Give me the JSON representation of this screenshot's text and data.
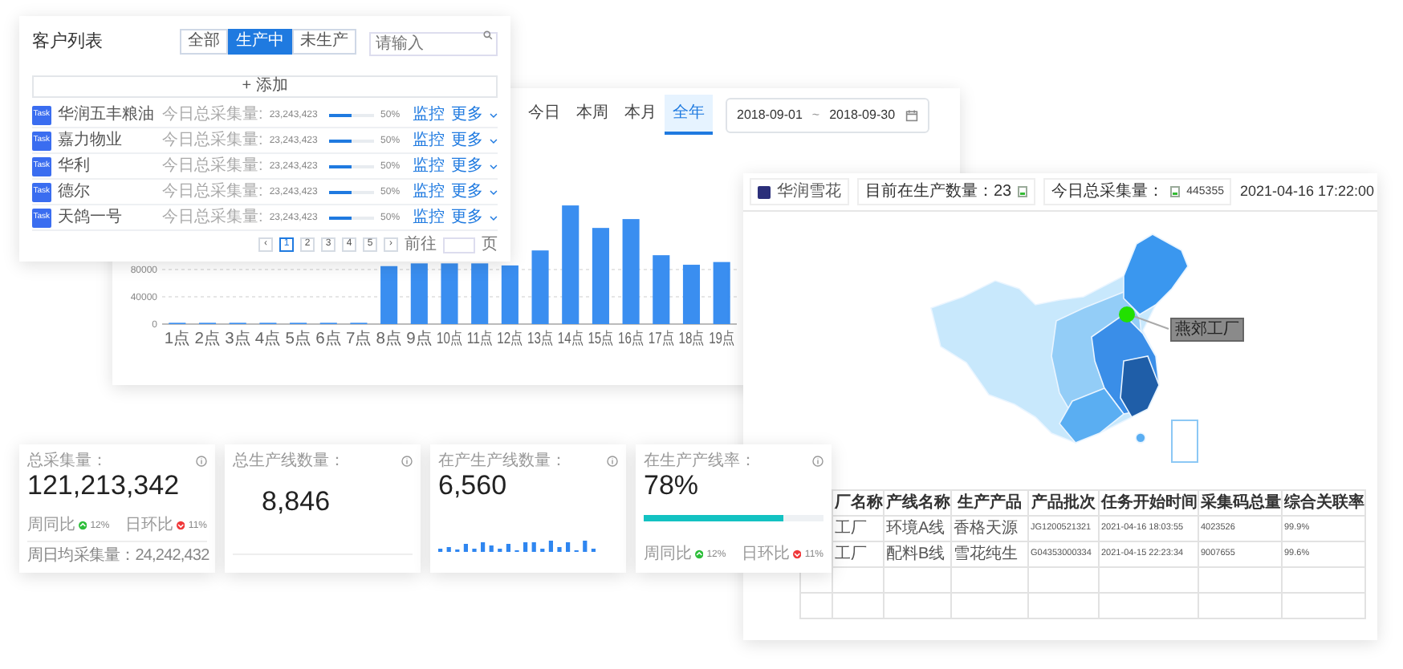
{
  "customer_list": {
    "title": "客户列表",
    "filters": [
      {
        "label": "全部",
        "selected": false
      },
      {
        "label": "生产中",
        "selected": true
      },
      {
        "label": "未生产",
        "selected": false
      }
    ],
    "search": {
      "placeholder": "请输入"
    },
    "add_button": "+ 添加",
    "rows": [
      {
        "badge": "Task",
        "name": "华润五丰粮油",
        "label": "今日总采集量:",
        "value": "23,243,423",
        "level": 0.5,
        "percent": "50%",
        "action": "监控",
        "more": "更多"
      },
      {
        "badge": "Task",
        "name": "嘉力物业",
        "label": "今日总采集量:",
        "value": "23,243,423",
        "level": 0.5,
        "percent": "50%",
        "action": "监控",
        "more": "更多"
      },
      {
        "badge": "Task",
        "name": "华利",
        "label": "今日总采集量:",
        "value": "23,243,423",
        "level": 0.5,
        "percent": "50%",
        "action": "监控",
        "more": "更多"
      },
      {
        "badge": "Task",
        "name": "德尔",
        "label": "今日总采集量:",
        "value": "23,243,423",
        "level": 0.5,
        "percent": "50%",
        "action": "监控",
        "more": "更多"
      },
      {
        "badge": "Task",
        "name": "天鸽一号",
        "label": "今日总采集量:",
        "value": "23,243,423",
        "level": 0.5,
        "percent": "50%",
        "action": "监控",
        "more": "更多"
      }
    ],
    "pagination": {
      "prev": "‹",
      "pages": [
        {
          "label": "1",
          "selected": true
        },
        {
          "label": "2",
          "selected": false
        },
        {
          "label": "3",
          "selected": false
        },
        {
          "label": "4",
          "selected": false
        },
        {
          "label": "5",
          "selected": false
        }
      ],
      "next": "›",
      "goto_label": "前往",
      "goto_suffix": "页"
    }
  },
  "trend_chart": {
    "tabs": [
      {
        "label": "今日",
        "selected": false
      },
      {
        "label": "本周",
        "selected": false
      },
      {
        "label": "本月",
        "selected": false
      },
      {
        "label": "全年",
        "selected": true
      }
    ],
    "date_start": "2018-09-01",
    "date_separator": "~",
    "date_end": "2018-09-30",
    "chart_data": {
      "type": "bar",
      "categories": [
        "1点",
        "2点",
        "3点",
        "4点",
        "5点",
        "6点",
        "7点",
        "8点",
        "9点",
        "10点",
        "11点",
        "12点",
        "13点",
        "14点",
        "15点",
        "16点",
        "17点",
        "18点",
        "19点"
      ],
      "series": [
        {
          "color": "#3a8ef0",
          "values": [
            0,
            0,
            0,
            0,
            0,
            0,
            0,
            85000,
            89000,
            89000,
            89000,
            86000,
            108000,
            174000,
            141000,
            154000,
            101000,
            87000,
            91000
          ]
        }
      ],
      "ylim": [
        0,
        180000
      ],
      "yticks": [
        0,
        40000,
        80000
      ]
    }
  },
  "stats": [
    {
      "kind": "footer",
      "label": "总采集量：",
      "value": "121,213,342",
      "trends": [
        {
          "label": "周同比",
          "up": true,
          "value": "12%"
        },
        {
          "label": "日环比",
          "up": false,
          "value": "11%"
        }
      ],
      "footer": "周日均采集量：24,242,432"
    },
    {
      "kind": "plain",
      "label": "总生产线数量：",
      "value": "8,846"
    },
    {
      "kind": "sparkline",
      "label": "在产生产线数量：",
      "value": "6,560"
    },
    {
      "kind": "progress",
      "label": "在生产产线率：",
      "value": "78%",
      "level": 0.78,
      "trends": [
        {
          "label": "周同比",
          "up": true,
          "value": "12%"
        },
        {
          "label": "日环比",
          "up": false,
          "value": "11%"
        }
      ]
    }
  ],
  "factory_map": {
    "brand": "华润雪花",
    "producing": "目前在生产数量：23",
    "total_label": "今日总采集量：",
    "total_value": "445355",
    "datetime": "2021-04-16 17:22:00",
    "marker_label": "燕郊工厂",
    "table": {
      "columns": [
        "厂名称",
        "产线名称",
        "生产产品",
        "产品批次",
        "任务开始时间",
        "采集码总量",
        "综合关联率"
      ],
      "rows": [
        [
          "工厂",
          "环境A线",
          "香格天源",
          "JG1200521321",
          "2021-04-16 18:03:55",
          "4023526",
          "99.9%"
        ],
        [
          "工厂",
          "配料B线",
          "雪花纯生",
          "G04353000334",
          "2021-04-15 22:23:34",
          "9007655",
          "99.6%"
        ]
      ]
    }
  }
}
